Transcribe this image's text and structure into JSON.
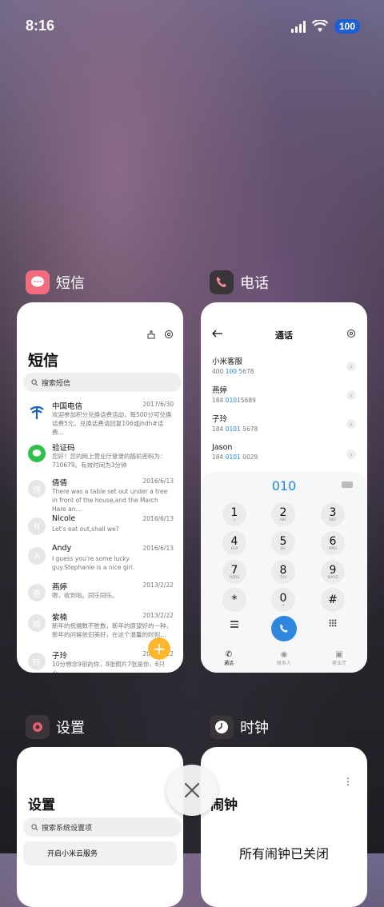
{
  "status": {
    "time": "8:16",
    "battery": "100"
  },
  "apps": {
    "sms": {
      "label": "短信",
      "title": "短信",
      "search_placeholder": "搜索短信",
      "messages": [
        {
          "name": "中国电信",
          "date": "2017/6/30",
          "preview": "欢迎参加积分兑换话费活动，每500分可兑换话费5元，兑换话费请回复106或jhdh#话费…",
          "avatar": "telecom"
        },
        {
          "name": "验证码",
          "date": "",
          "preview": "您好！您的网上营业厅登录的随机密码为：710679。有效时间为3分钟",
          "avatar": "green"
        },
        {
          "name": "倩倩",
          "date": "2016/6/13",
          "preview": "There was a table set out under a tree in front of the house,and the March Hare an…",
          "avatar": "倩"
        },
        {
          "name": "Nicole",
          "date": "2016/6/13",
          "preview": "Let's eat out,shall we?",
          "avatar": "N"
        },
        {
          "name": "Andy",
          "date": "2016/6/13",
          "preview": "I guess you're some lucky guy.Stephanie is a nice girl.",
          "avatar": "A"
        },
        {
          "name": "燕婷",
          "date": "2013/2/22",
          "preview": "嗯，收到啦。同乐同乐。",
          "avatar": "燕"
        },
        {
          "name": "紫楠",
          "date": "2013/2/22",
          "preview": "新年的祝福数不胜数，新年的原望好的一种，新年的问候依旧美好，在这个温馨的时刻…",
          "avatar": "楠"
        },
        {
          "name": "子玲",
          "date": "2013/2/22",
          "preview": "10分想念9别的你，8张照片7张是你，6只小…",
          "avatar": "玲"
        }
      ],
      "fab": "+"
    },
    "phone": {
      "label": "电话",
      "title": "通话",
      "contacts": [
        {
          "name": "小米客服",
          "num_pre": "400 ",
          "num_hl": "100",
          "num_post": " 5678"
        },
        {
          "name": "燕婷",
          "num_pre": "184 ",
          "num_hl": "010",
          "num_post": "15689"
        },
        {
          "name": "子玲",
          "num_pre": "184 ",
          "num_hl": "0101",
          "num_post": " 5678"
        },
        {
          "name": "Jason",
          "num_pre": "184 ",
          "num_hl": "0101",
          "num_post": " 0029"
        }
      ],
      "dial_input": "010",
      "keys": [
        {
          "d": "1",
          "l": "∞"
        },
        {
          "d": "2",
          "l": "ABC"
        },
        {
          "d": "3",
          "l": "DEF"
        },
        {
          "d": "4",
          "l": "GHI"
        },
        {
          "d": "5",
          "l": "JKL"
        },
        {
          "d": "6",
          "l": "MNO"
        },
        {
          "d": "7",
          "l": "PQRS"
        },
        {
          "d": "8",
          "l": "TUV"
        },
        {
          "d": "9",
          "l": "WXYZ"
        },
        {
          "d": "*",
          "l": ""
        },
        {
          "d": "0",
          "l": "+"
        },
        {
          "d": "#",
          "l": ""
        }
      ],
      "tabs": [
        "通话",
        "联系人",
        "营业厅"
      ]
    },
    "settings": {
      "label": "设置",
      "title": "设置",
      "search_placeholder": "搜索系统设置项",
      "first_item": "开启小米云服务"
    },
    "clock": {
      "label": "时钟",
      "title": "闹钟",
      "empty_text": "所有闹钟已关闭"
    }
  }
}
